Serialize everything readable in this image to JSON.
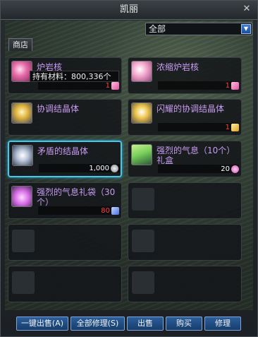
{
  "window": {
    "title": "凯丽",
    "close_glyph": "✕"
  },
  "filter": {
    "selected": "全部"
  },
  "tab": {
    "label": "商店"
  },
  "items": [
    {
      "name": "炉岩核",
      "price": "1",
      "price_color": "#ff4040",
      "currency_icon": "pink-crystal-icon",
      "icon_color": "#e86aa8"
    },
    {
      "name": "浓缩炉岩核",
      "price": "1",
      "price_color": "#ff4040",
      "currency_icon": "pink-crystal-icon",
      "icon_color": "#f0a0c8"
    },
    {
      "name": "协调结晶体",
      "price": "",
      "price_color": "#ffffff",
      "currency_icon": "",
      "icon_color": "#e2b640"
    },
    {
      "name": "闪耀的协调结晶体",
      "price": "1",
      "price_color": "#ff4040",
      "currency_icon": "gold-crystal-icon",
      "icon_color": "#f0c850"
    },
    {
      "name": "矛盾的结晶体",
      "price": "1,000",
      "price_color": "#ffffff",
      "currency_icon": "silver-coin-icon",
      "icon_color": "#b8c4d8"
    },
    {
      "name": "强烈的气息（10个）礼盒",
      "price": "20",
      "price_color": "#ffffff",
      "currency_icon": "pink-gem-icon",
      "icon_color": "#7ad05a"
    },
    {
      "name": "强烈的气息礼袋（30个）",
      "price": "80",
      "price_color": "#ff4040",
      "currency_icon": "blue-wand-icon",
      "icon_color": "#d870e8"
    }
  ],
  "tooltip": {
    "text": "持有材料：800,336个"
  },
  "buttons": {
    "sell_all": "一键出售(A)",
    "repair_all": "全部修理(S)",
    "sell": "出售",
    "buy": "购买",
    "repair": "修理"
  }
}
